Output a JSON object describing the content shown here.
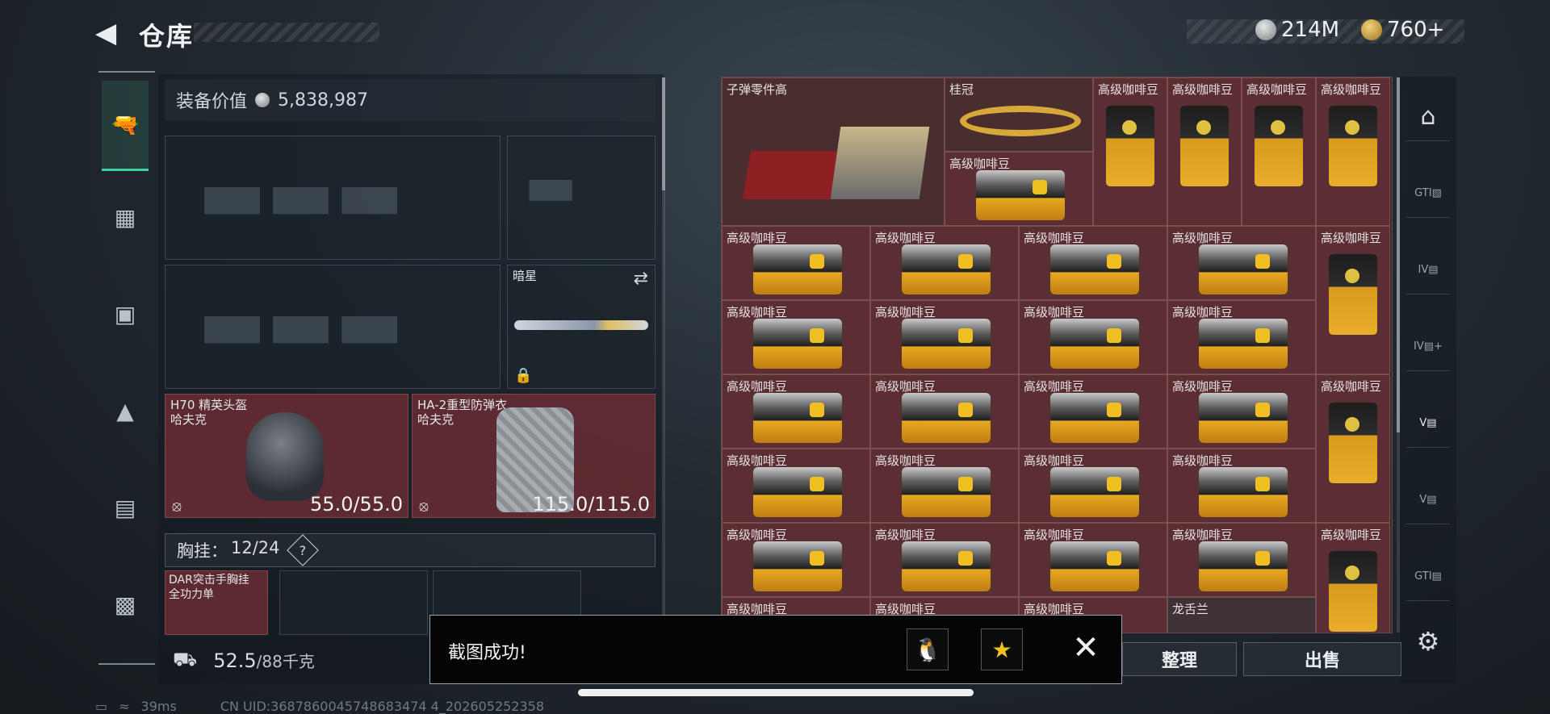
{
  "header": {
    "title": "仓库",
    "silver_amount": "214M",
    "gold_amount": "760+"
  },
  "left_rail": {
    "items": [
      {
        "icon": "pistol-icon"
      },
      {
        "icon": "vest-icon"
      },
      {
        "icon": "backpack-icon"
      },
      {
        "icon": "bag-icon"
      },
      {
        "icon": "locker-icon"
      },
      {
        "icon": "briefcase-icon"
      }
    ]
  },
  "equipment": {
    "value_label": "装备价值",
    "value": "5,838,987",
    "melee_name": "暗星",
    "helmet": {
      "name": "H70 精英头盔",
      "brand": "哈夫克",
      "durability": "55.0/55.0"
    },
    "armor": {
      "name": "HA-2重型防弹衣",
      "brand": "哈夫克",
      "durability": "115.0/115.0"
    },
    "rig_label": "胸挂：",
    "rig_count": "12/24",
    "rig_help": "?",
    "rig_item": "DAR突击手胸挂",
    "rig_item_sub": "全功力单",
    "weight_current": "52.5",
    "weight_max": "/88千克"
  },
  "grid": {
    "item_parts": "子弹零件高",
    "item_crown": "桂冠",
    "item_coffee": "高级咖啡豆",
    "item_dragon": "龙舌兰"
  },
  "actions": {
    "sort": "整理",
    "sell": "出售"
  },
  "toast": {
    "message": "截图成功!",
    "close": "✕"
  },
  "status": {
    "ping": "39ms",
    "uid": "CN UID:3687860045748683474 4_202605252358"
  },
  "colors": {
    "accent": "#3fd0a0",
    "item_red": "#5a2e33",
    "coffee_gold": "#e5a820"
  }
}
